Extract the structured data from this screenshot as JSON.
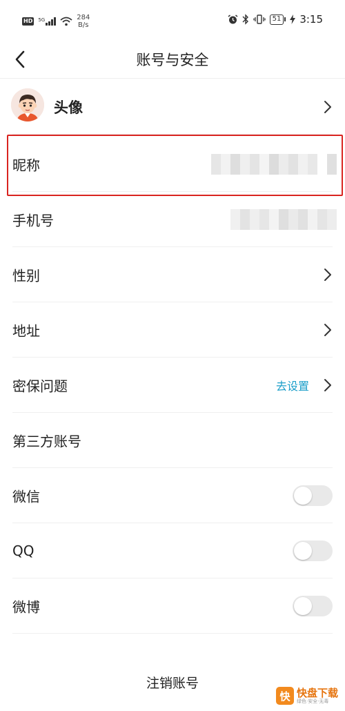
{
  "status_bar": {
    "hd_badge": "HD",
    "network_type": "5G",
    "net_speed_value": "284",
    "net_speed_unit": "B/s",
    "battery_level": "51",
    "time": "3:15"
  },
  "nav": {
    "title": "账号与安全",
    "back_icon": "chevron-left-icon"
  },
  "rows": {
    "avatar": {
      "label": "头像"
    },
    "nickname": {
      "label": "昵称"
    },
    "phone": {
      "label": "手机号"
    },
    "gender": {
      "label": "性别"
    },
    "address": {
      "label": "地址"
    },
    "security_question": {
      "label": "密保问题",
      "action": "去设置"
    },
    "third_party": {
      "label": "第三方账号"
    },
    "wechat": {
      "label": "微信",
      "enabled": false
    },
    "qq": {
      "label": "QQ",
      "enabled": false
    },
    "weibo": {
      "label": "微博",
      "enabled": false
    }
  },
  "footer": {
    "cancel_account": "注销账号"
  },
  "watermark": {
    "logo_char": "快",
    "name": "快盘下载",
    "tagline": "绿色·安全·无毒"
  },
  "colors": {
    "accent_link": "#1a9ec9",
    "highlight_border": "#d9231f",
    "toggle_off": "#e9e9e9"
  }
}
